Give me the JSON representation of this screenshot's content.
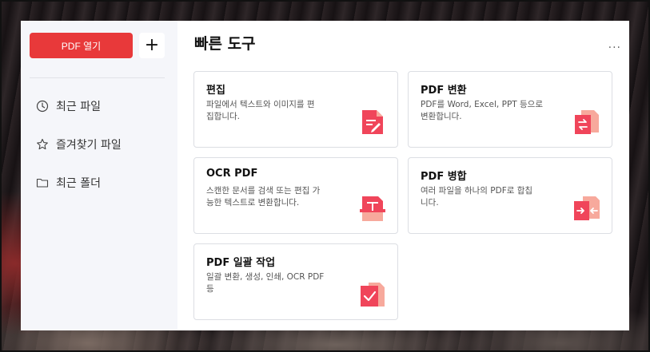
{
  "sidebar": {
    "open_button_label": "PDF 열기",
    "add_button_label": "+",
    "items": [
      {
        "label": "최근 파일",
        "icon": "clock-icon"
      },
      {
        "label": "즐겨찾기 파일",
        "icon": "star-icon"
      },
      {
        "label": "최근 폴더",
        "icon": "folder-icon"
      }
    ]
  },
  "main": {
    "title": "빠른 도구",
    "more_label": "...",
    "cards": [
      {
        "title": "편집",
        "desc": "파일에서 텍스트와 이미지를 편\n집합니다.",
        "icon": "edit-document-icon"
      },
      {
        "title": "PDF 변환",
        "desc": "PDF를 Word, Excel, PPT 등으로\n변환합니다.",
        "icon": "convert-icon"
      },
      {
        "title": "OCR PDF",
        "desc": "스캔한 문서를 검색 또는 편집 가\n능한 텍스트로 변환합니다.",
        "icon": "ocr-scan-icon"
      },
      {
        "title": "PDF 병합",
        "desc": "여러 파일을 하나의 PDF로 합칩\n니다.",
        "icon": "merge-icon"
      },
      {
        "title": "PDF 일괄 작업",
        "desc": "일괄 변환, 생성, 인쇄, OCR PDF\n등",
        "icon": "batch-check-icon"
      }
    ]
  },
  "colors": {
    "accent": "#e8393a",
    "icon_light": "#f7a99c"
  }
}
